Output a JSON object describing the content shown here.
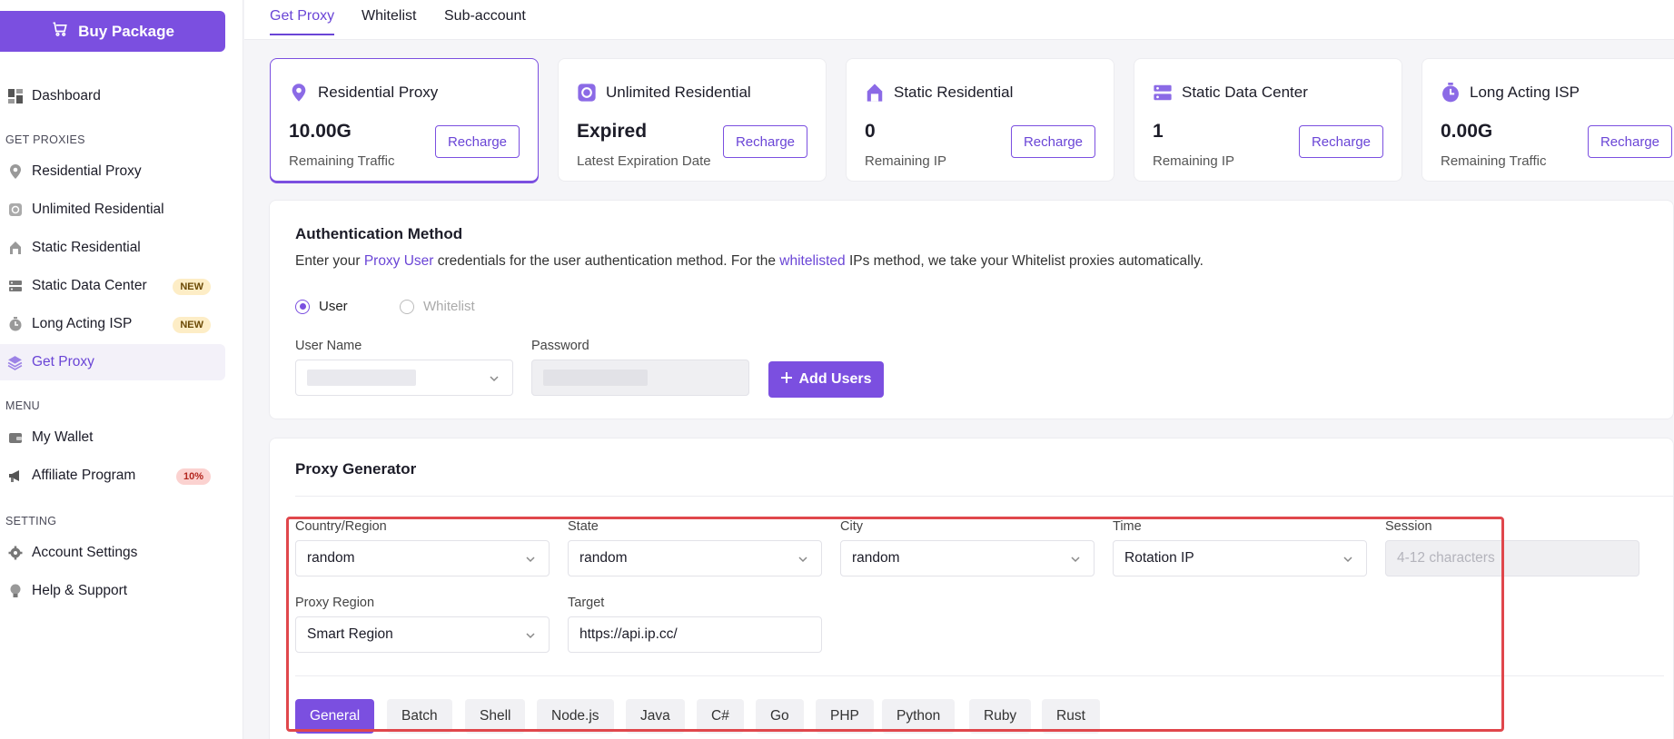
{
  "sidebar": {
    "buy_label": "Buy Package",
    "dashboard": "Dashboard",
    "section_proxies": "GET PROXIES",
    "items_proxies": [
      "Residential Proxy",
      "Unlimited Residential",
      "Static Residential",
      "Static Data Center",
      "Long Acting ISP",
      "Get Proxy"
    ],
    "badge_new": "NEW",
    "section_menu": "MENU",
    "wallet": "My Wallet",
    "affiliate": "Affiliate Program",
    "affiliate_badge": "10%",
    "section_setting": "SETTING",
    "account_settings": "Account Settings",
    "help": "Help & Support"
  },
  "tabs": [
    "Get Proxy",
    "Whitelist",
    "Sub-account"
  ],
  "cards": [
    {
      "title": "Residential Proxy",
      "value": "10.00G",
      "sub": "Remaining Traffic"
    },
    {
      "title": "Unlimited Residential",
      "value": "Expired",
      "sub": "Latest Expiration Date"
    },
    {
      "title": "Static Residential",
      "value": "0",
      "sub": "Remaining IP"
    },
    {
      "title": "Static Data Center",
      "value": "1",
      "sub": "Remaining IP"
    },
    {
      "title": "Long Acting ISP",
      "value": "0.00G",
      "sub": "Remaining Traffic"
    }
  ],
  "recharge_label": "Recharge",
  "auth": {
    "title": "Authentication Method",
    "desc_1": "Enter your ",
    "desc_link1": "Proxy User",
    "desc_2": " credentials for the user authentication method. For the ",
    "desc_link2": "whitelisted",
    "desc_3": " IPs method, we take your Whitelist proxies automatically.",
    "radio_user": "User",
    "radio_whitelist": "Whitelist",
    "username_label": "User Name",
    "password_label": "Password",
    "add_users": "Add Users"
  },
  "generator": {
    "title": "Proxy Generator",
    "country_label": "Country/Region",
    "country_value": "random",
    "state_label": "State",
    "state_value": "random",
    "city_label": "City",
    "city_value": "random",
    "time_label": "Time",
    "time_value": "Rotation IP",
    "session_label": "Session",
    "session_placeholder": "4-12 characters",
    "region_label": "Proxy Region",
    "region_value": "Smart Region",
    "target_label": "Target",
    "target_value": "https://api.ip.cc/",
    "code_tabs": [
      "General",
      "Batch",
      "Shell",
      "Node.js",
      "Java",
      "C#",
      "Go",
      "PHP",
      "Python",
      "Ruby",
      "Rust"
    ]
  },
  "colors": {
    "accent": "#7b4fe0",
    "highlight": "#e0474c"
  }
}
